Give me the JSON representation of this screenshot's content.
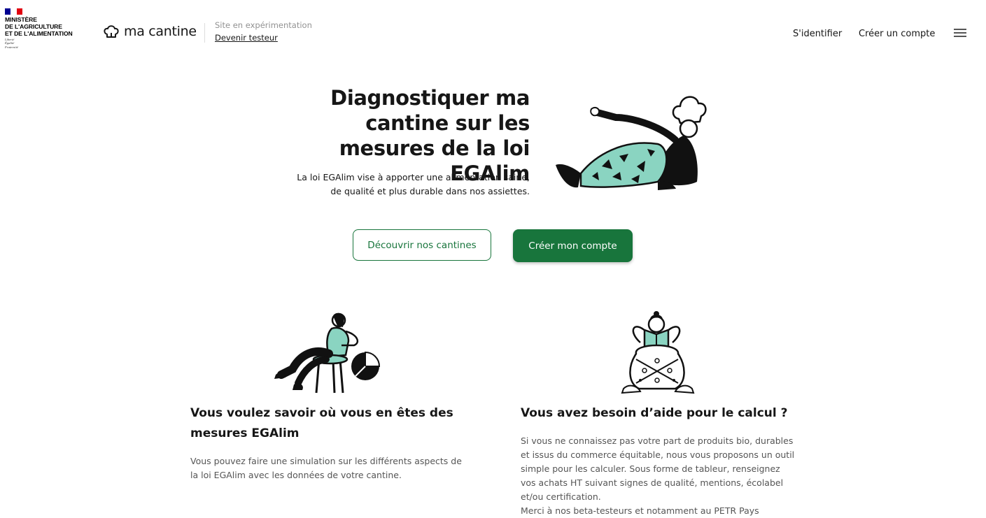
{
  "header": {
    "gov_name": "MINISTÈRE\nDE L'AGRICULTURE\nET DE L'ALIMENTATION",
    "gov_motto": "Liberté\nÉgalité\nFraternité",
    "site_name": "ma cantine",
    "experiment_text": "Site en expérimentation",
    "tester_link": "Devenir testeur",
    "nav": {
      "login": "S'identifier",
      "signup": "Créer un compte"
    },
    "menu_icon": "hamburger-menu-icon",
    "flag_colors": [
      "#000091",
      "#ffffff",
      "#e1000f"
    ]
  },
  "hero": {
    "title": "Diagnostiquer ma cantine sur les mesures de la loi EGAlim",
    "subtitle_line1": "La loi EGAlim vise à apporter une alimentation saine,",
    "subtitle_line2": "de qualité et plus durable dans nos assiettes.",
    "illustration": "chef-lying-illustration",
    "buttons": {
      "discover": "Découvrir nos cantines",
      "create": "Créer mon compte"
    }
  },
  "features": [
    {
      "illustration": "person-chair-piechart-illustration",
      "title": "Vous voulez savoir où vous en êtes des mesures EGAlim",
      "text": "Vous pouvez faire une simulation sur les différents aspects de la loi EGAlim avec les données de votre cantine."
    },
    {
      "illustration": "person-reading-illustration",
      "title": "Vous avez besoin d’aide pour le calcul ?",
      "text": "Si vous ne connaissez pas votre part de produits bio, durables et issus du commerce équitable, nous vous proposons un outil simple pour les calculer. Sous forme de tableur, renseignez vos achats HT suivant signes de qualité, mentions, écolabel et/ou certification.",
      "text_more": "Merci à nos beta-testeurs et notamment au PETR Pays"
    }
  ],
  "colors": {
    "primary": "#18753c",
    "illustration_accent": "#8ad4c1"
  }
}
